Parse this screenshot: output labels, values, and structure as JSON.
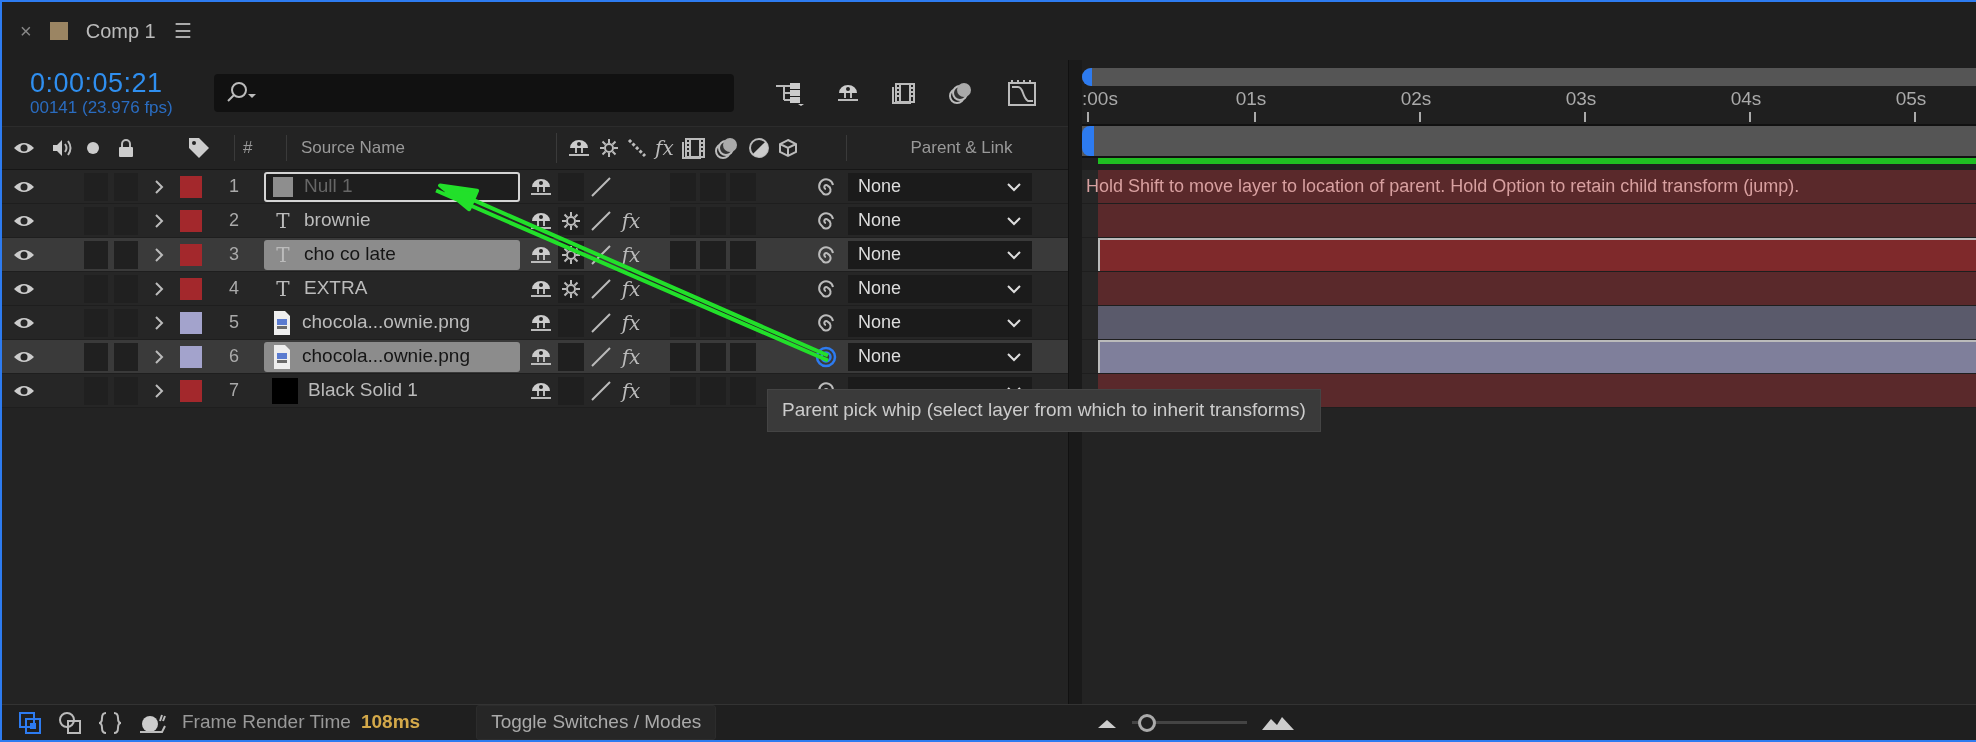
{
  "tab": {
    "close": "×",
    "title": "Comp 1",
    "menu": "☰"
  },
  "timecode": "0:00:05:21",
  "frame_info": "00141 (23.976 fps)",
  "columns": {
    "number": "#",
    "source_name": "Source Name",
    "fx": "fx",
    "parent": "Parent & Link"
  },
  "layers": [
    {
      "number": "1",
      "name": "Null 1",
      "kind": "null",
      "color": "#a3282c",
      "selected": false,
      "targeted": true,
      "collapse": false,
      "parent": "None",
      "pickwhip_active": false
    },
    {
      "number": "2",
      "name": "brownie",
      "kind": "text",
      "icon": "T",
      "color": "#a3282c",
      "selected": false,
      "targeted": false,
      "collapse": true,
      "fx": "fx",
      "parent": "None",
      "pickwhip_active": false
    },
    {
      "number": "3",
      "name": "cho co late",
      "kind": "text",
      "icon": "T",
      "color": "#a3282c",
      "selected": true,
      "targeted": false,
      "collapse": true,
      "fx": "fx",
      "parent": "None",
      "pickwhip_active": false
    },
    {
      "number": "4",
      "name": "EXTRA",
      "kind": "text",
      "icon": "T",
      "color": "#a3282c",
      "selected": false,
      "targeted": false,
      "collapse": true,
      "fx": "fx",
      "parent": "None",
      "pickwhip_active": false
    },
    {
      "number": "5",
      "name": "chocola...ownie.png",
      "kind": "image",
      "color": "#a3a3cc",
      "selected": false,
      "targeted": false,
      "collapse": false,
      "fx": "fx",
      "parent": "None",
      "pickwhip_active": false
    },
    {
      "number": "6",
      "name": "chocola...ownie.png",
      "kind": "image",
      "color": "#a3a3cc",
      "selected": true,
      "targeted": false,
      "collapse": false,
      "fx": "fx",
      "parent": "None",
      "pickwhip_active": true
    },
    {
      "number": "7",
      "name": "Black Solid 1",
      "kind": "solid",
      "color": "#a3282c",
      "selected": false,
      "targeted": false,
      "collapse": false,
      "fx": "fx",
      "pickwhip_active": false
    }
  ],
  "render_progress": {
    "level": 1
  },
  "zoom": {
    "level": 0.06
  },
  "ruler": [
    ":00s",
    "01s",
    "02s",
    "03s",
    "04s",
    "05s"
  ],
  "hint": "Hold Shift to move layer to location of parent. Hold Option to retain child transform (jump).",
  "tooltip": "Parent pick whip (select layer from which to inherit transforms)",
  "status": {
    "label": "Frame Render Time",
    "value": "108ms",
    "toggle": "Toggle Switches / Modes"
  }
}
